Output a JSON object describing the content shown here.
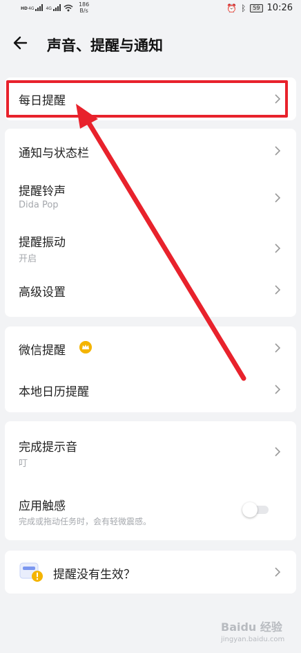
{
  "status_bar": {
    "hd_label": "HD",
    "network_gen": "4G",
    "speed_value": "186",
    "speed_unit": "B/s",
    "battery": "59",
    "time": "10:26"
  },
  "header": {
    "title": "声音、提醒与通知"
  },
  "sections": {
    "daily": {
      "label": "每日提醒"
    },
    "general": {
      "items": [
        {
          "label": "通知与状态栏",
          "sub": ""
        },
        {
          "label": "提醒铃声",
          "sub": "Dida Pop"
        },
        {
          "label": "提醒振动",
          "sub": "开启"
        },
        {
          "label": "高级设置",
          "sub": ""
        }
      ]
    },
    "wechat": {
      "items": [
        {
          "label": "微信提醒"
        },
        {
          "label": "本地日历提醒"
        }
      ]
    },
    "completion": {
      "sound_label": "完成提示音",
      "sound_sub": "叮",
      "haptic_label": "应用触感",
      "haptic_sub": "完成或拖动任务时，会有轻微震感。",
      "haptic_enabled": false
    },
    "help": {
      "label": "提醒没有生效？"
    }
  },
  "watermark": {
    "brand": "Baidu 经验",
    "url": "jingyan.baidu.com"
  },
  "colors": {
    "highlight": "#e8222c",
    "crown": "#f4b400",
    "help_icon_badge": "#f4b400",
    "help_icon_body": "#7b97f0"
  }
}
